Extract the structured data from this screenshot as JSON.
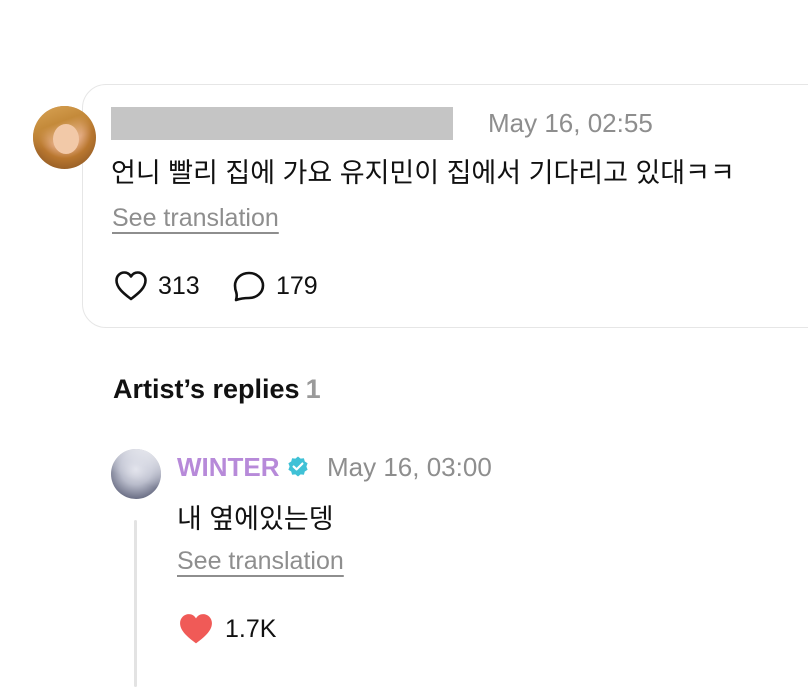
{
  "post": {
    "author_name": "",
    "timestamp": "May 16, 02:55",
    "text": "언니 빨리 집에 가요 유지민이 집에서 기다리고 있대ㅋㅋ",
    "see_translation": "See translation",
    "likes": "313",
    "comments": "179",
    "icons": [
      "heart-outline-icon",
      "comment-bubble-icon"
    ]
  },
  "artist_replies": {
    "title": "Artist’s replies",
    "count": "1"
  },
  "reply": {
    "author_name": "WINTER",
    "name_color": "#b78ad9",
    "verified_color": "#3fc1d6",
    "timestamp": "May 16, 03:00",
    "text": "내 옆에있는뎅",
    "see_translation": "See translation",
    "likes": "1.7K",
    "like_color": "#f05a57",
    "icons": [
      "verified-badge-icon",
      "heart-filled-icon"
    ]
  }
}
